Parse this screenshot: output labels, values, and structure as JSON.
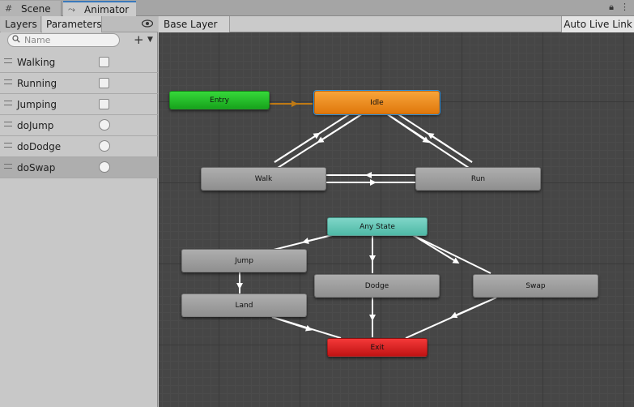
{
  "window_tabs": [
    {
      "label": "Scene",
      "icon": "grid-icon"
    },
    {
      "label": "Animator",
      "icon": "animator-icon"
    }
  ],
  "panel_tabs": {
    "layers": "Layers",
    "parameters": "Parameters"
  },
  "search": {
    "placeholder": "Name"
  },
  "parameters": [
    {
      "name": "Walking",
      "type": "bool"
    },
    {
      "name": "Running",
      "type": "bool"
    },
    {
      "name": "Jumping",
      "type": "bool"
    },
    {
      "name": "doJump",
      "type": "trigger"
    },
    {
      "name": "doDodge",
      "type": "trigger"
    },
    {
      "name": "doSwap",
      "type": "trigger",
      "selected": true
    }
  ],
  "graph_bar": {
    "breadcrumb": "Base Layer",
    "live_link": "Auto Live Link"
  },
  "states": {
    "entry": "Entry",
    "idle": "Idle",
    "walk": "Walk",
    "run": "Run",
    "any_state": "Any State",
    "jump": "Jump",
    "land": "Land",
    "dodge": "Dodge",
    "swap": "Swap",
    "exit": "Exit"
  },
  "colors": {
    "entry": "#25c12a",
    "idle": "#ec8c23",
    "any_state": "#66c9b7",
    "exit": "#da2424",
    "default_state": "#9e9e9e",
    "default_transition": "#c07a14",
    "transition": "#ffffff",
    "selection": "#2c8fdb"
  }
}
